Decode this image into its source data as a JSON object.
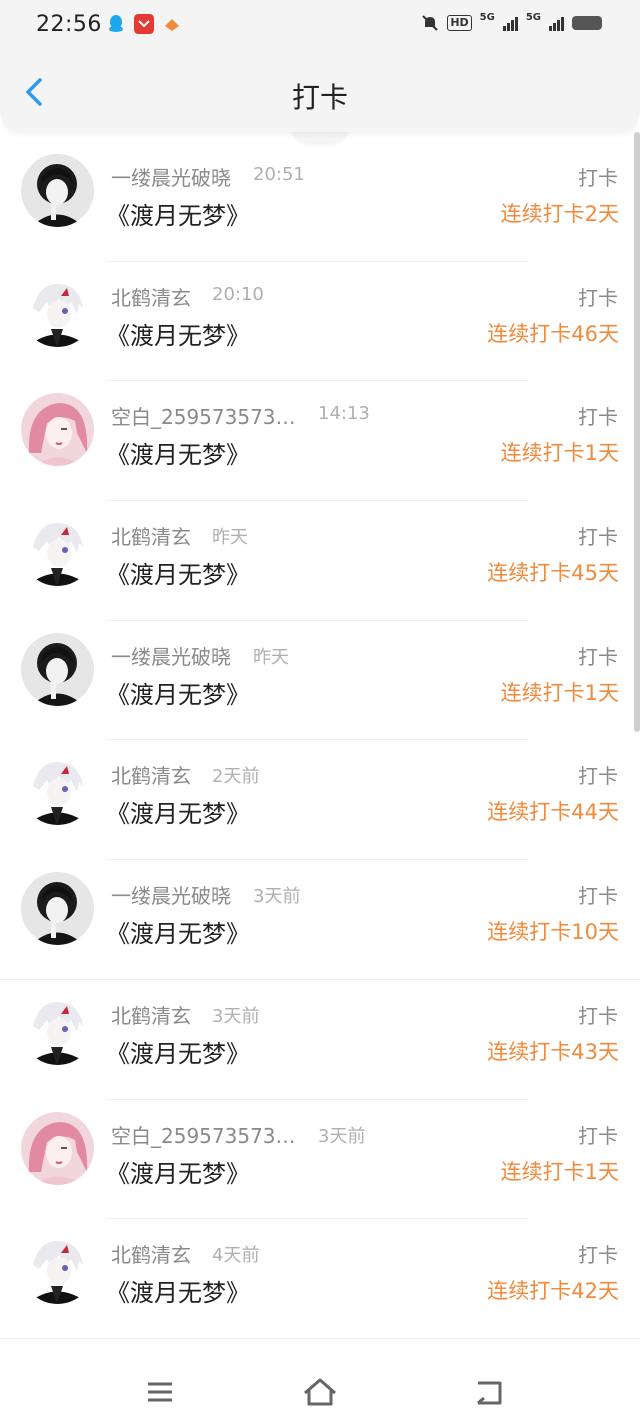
{
  "status_bar": {
    "time": "22:56",
    "hd_label": "HD",
    "net1_label": "5G",
    "net2_label": "5G"
  },
  "header": {
    "title": "打卡",
    "back_icon": "chevron-left-icon"
  },
  "colors": {
    "accent_blue": "#2f9bf0",
    "streak_orange": "#f08a3c"
  },
  "items": [
    {
      "user": "一缕晨光破晓",
      "time": "20:51",
      "book": "《渡月无梦》",
      "action": "打卡",
      "streak": "连续打卡2天",
      "avatar": "dark-hair-avatar"
    },
    {
      "user": "北鹤清玄",
      "time": "20:10",
      "book": "《渡月无梦》",
      "action": "打卡",
      "streak": "连续打卡46天",
      "avatar": "white-hair-avatar"
    },
    {
      "user": "空白_259573573…",
      "time": "14:13",
      "book": "《渡月无梦》",
      "action": "打卡",
      "streak": "连续打卡1天",
      "avatar": "pink-hair-avatar"
    },
    {
      "user": "北鹤清玄",
      "time": "昨天",
      "book": "《渡月无梦》",
      "action": "打卡",
      "streak": "连续打卡45天",
      "avatar": "white-hair-avatar"
    },
    {
      "user": "一缕晨光破晓",
      "time": "昨天",
      "book": "《渡月无梦》",
      "action": "打卡",
      "streak": "连续打卡1天",
      "avatar": "dark-hair-avatar"
    },
    {
      "user": "北鹤清玄",
      "time": "2天前",
      "book": "《渡月无梦》",
      "action": "打卡",
      "streak": "连续打卡44天",
      "avatar": "white-hair-avatar"
    },
    {
      "user": "一缕晨光破晓",
      "time": "3天前",
      "book": "《渡月无梦》",
      "action": "打卡",
      "streak": "连续打卡10天",
      "avatar": "dark-hair-avatar"
    },
    {
      "user": "北鹤清玄",
      "time": "3天前",
      "book": "《渡月无梦》",
      "action": "打卡",
      "streak": "连续打卡43天",
      "avatar": "white-hair-avatar"
    },
    {
      "user": "空白_259573573…",
      "time": "3天前",
      "book": "《渡月无梦》",
      "action": "打卡",
      "streak": "连续打卡1天",
      "avatar": "pink-hair-avatar"
    },
    {
      "user": "北鹤清玄",
      "time": "4天前",
      "book": "《渡月无梦》",
      "action": "打卡",
      "streak": "连续打卡42天",
      "avatar": "white-hair-avatar"
    }
  ],
  "bottom_nav": [
    "menu-icon",
    "home-icon",
    "back-icon"
  ]
}
